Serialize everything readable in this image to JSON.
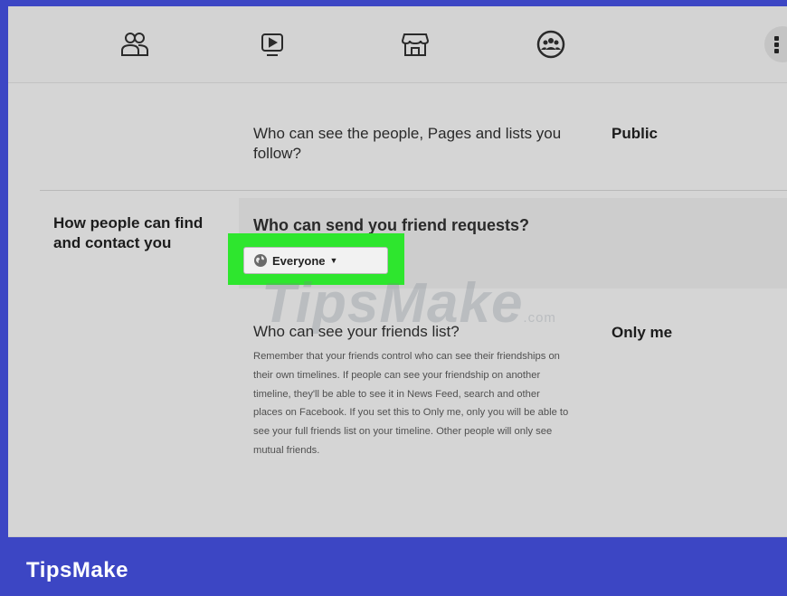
{
  "nav": {
    "icons": [
      "friends-icon",
      "watch-icon",
      "marketplace-icon",
      "groups-icon",
      "more-icon"
    ]
  },
  "rows": {
    "follow": {
      "question": "Who can see the people, Pages and lists you follow?",
      "value": "Public"
    },
    "find_contact": {
      "section_label": "How people can find and contact you",
      "question": "Who can send you friend requests?",
      "dropdown_value": "Everyone"
    },
    "friends_list": {
      "question": "Who can see your friends list?",
      "value": "Only me",
      "description": "Remember that your friends control who can see their friendships on their own timelines. If people can see your friendship on another timeline, they'll be able to see it in News Feed, search and other places on Facebook. If you set this to Only me, only you will be able to see your full friends list on your timeline. Other people will only see mutual friends."
    }
  },
  "watermark": {
    "text": "TipsMake",
    "suffix": ".com"
  },
  "footer": {
    "brand": "TipsMake"
  },
  "colors": {
    "frame": "#3c46c4",
    "highlight": "#2ee62e"
  }
}
